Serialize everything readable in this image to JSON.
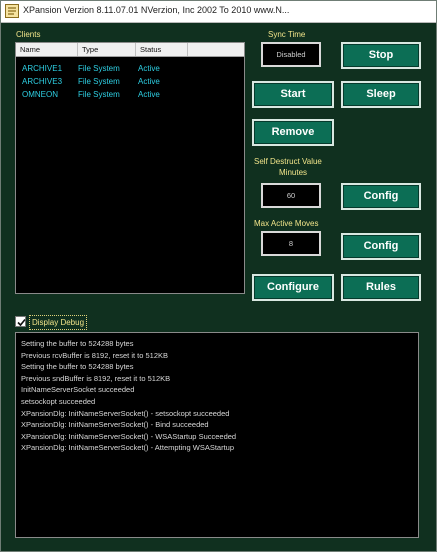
{
  "window": {
    "title": "XPansion Verzion   8.11.07.01 NVerzion, Inc 2002 To 2010  www.N..."
  },
  "clients": {
    "label": "Clients",
    "columns": [
      "Name",
      "Type",
      "Status"
    ],
    "rows": [
      {
        "name": "ARCHIVE1",
        "type": "File System",
        "status": "Active"
      },
      {
        "name": "ARCHIVE3",
        "type": "File System",
        "status": "Active"
      },
      {
        "name": "OMNEON",
        "type": "File System",
        "status": "Active"
      }
    ]
  },
  "sync": {
    "label": "Sync Time",
    "value": "Disabled"
  },
  "buttons": {
    "stop": "Stop",
    "start": "Start",
    "sleep": "Sleep",
    "remove": "Remove",
    "config1": "Config",
    "config2": "Config",
    "configure": "Configure",
    "rules": "Rules"
  },
  "self_destruct": {
    "label_line1": "Self Destruct Value",
    "label_line2": "Minutes",
    "value": "60"
  },
  "max_active": {
    "label": "Max Active Moves",
    "value": "8"
  },
  "debug": {
    "checkbox_label": "Display Debug",
    "checked": true,
    "lines": [
      "Setting the buffer to 524288 bytes",
      "Previous rcvBuffer is 8192, reset it to 512KB",
      "Setting the buffer to 524288 bytes",
      "Previous sndBuffer is 8192, reset it to 512KB",
      "InitNameServerSocket succeeded",
      "setsockopt succeeded",
      "XPansionDlg: InitNameServerSocket() - setsockopt succeeded",
      "XPansionDlg: InitNameServerSocket() - Bind succeeded",
      "XPansionDlg: InitNameServerSocket() - WSAStartup Succeeded",
      "XPansionDlg: InitNameServerSocket() - Attempting WSAStartup"
    ]
  },
  "colors": {
    "window_bg": "#10301f",
    "button_bg": "#0c6e55",
    "label_yellow": "#f2e58a",
    "client_text": "#2ecfe3"
  }
}
